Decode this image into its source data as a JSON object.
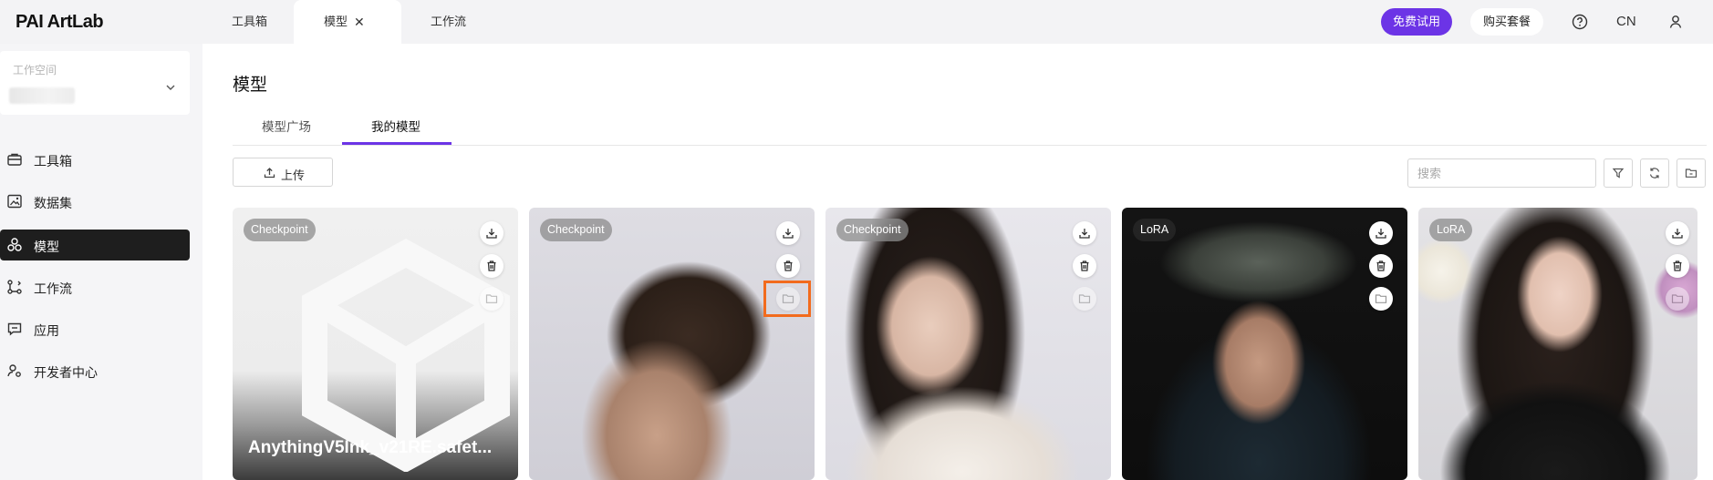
{
  "app": {
    "logo": "PAI ArtLab"
  },
  "topbar": {
    "tabs": [
      {
        "label": "工具箱"
      },
      {
        "label": "模型"
      },
      {
        "label": "工作流"
      }
    ],
    "trial_label": "免费试用",
    "buy_label": "购买套餐",
    "language": "CN"
  },
  "sidebar": {
    "workspace_label": "工作空间",
    "items": [
      {
        "label": "工具箱",
        "icon": "toolbox-icon"
      },
      {
        "label": "数据集",
        "icon": "dataset-icon"
      },
      {
        "label": "模型",
        "icon": "model-icon"
      },
      {
        "label": "工作流",
        "icon": "workflow-icon"
      },
      {
        "label": "应用",
        "icon": "app-icon"
      },
      {
        "label": "开发者中心",
        "icon": "developer-icon"
      }
    ]
  },
  "main": {
    "title": "模型",
    "subtabs": [
      {
        "label": "模型广场"
      },
      {
        "label": "我的模型"
      }
    ],
    "upload_label": "上传",
    "search_placeholder": "搜索",
    "cards": [
      {
        "type": "Checkpoint",
        "name": "AnythingV5Ink_v21RE.safet..."
      },
      {
        "type": "Checkpoint"
      },
      {
        "type": "Checkpoint"
      },
      {
        "type": "LoRA"
      },
      {
        "type": "LoRA"
      }
    ]
  },
  "colors": {
    "accent": "#6c34e6",
    "highlight": "#f26b1d",
    "active_nav": "#1e1e1e"
  }
}
